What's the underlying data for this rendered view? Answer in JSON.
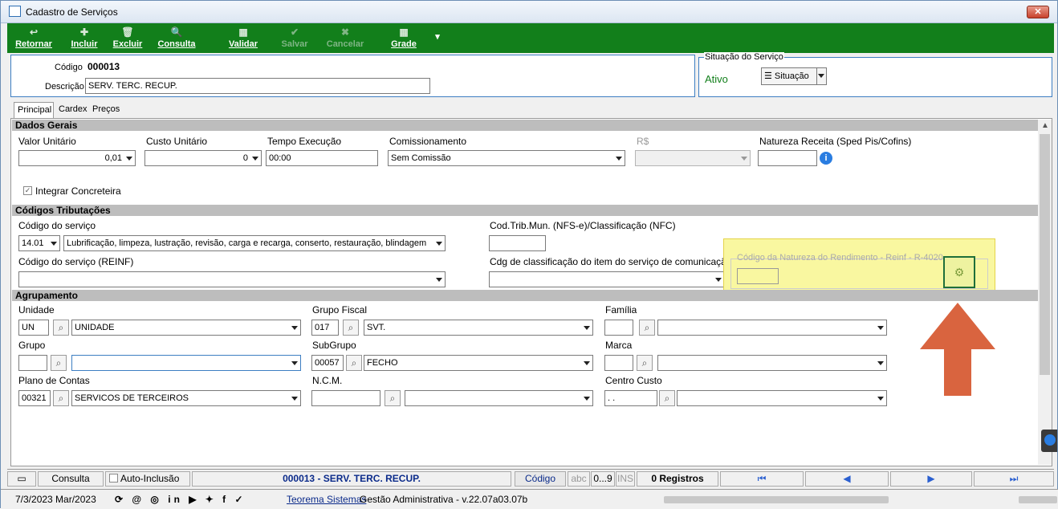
{
  "window": {
    "title": "Cadastro de Serviços",
    "close": "✕"
  },
  "toolbar": {
    "buttons": [
      {
        "label": "Retornar",
        "icon": "↩"
      },
      {
        "label": "Incluir",
        "icon": "✚"
      },
      {
        "label": "Excluir",
        "icon": "🗑"
      },
      {
        "label": "Consulta",
        "icon": "🔍"
      },
      {
        "label": "Validar",
        "icon": "▦"
      },
      {
        "label": "Salvar",
        "icon": "✔"
      },
      {
        "label": "Cancelar",
        "icon": "✖"
      },
      {
        "label": "Grade",
        "icon": "▦"
      }
    ],
    "more": "▾"
  },
  "header": {
    "codigo_label": "Código",
    "codigo_value": "000013",
    "descricao_label": "Descrição",
    "descricao_value": "SERV. TERC. RECUP."
  },
  "situacao": {
    "legend": "Situação do Serviço",
    "status": "Ativo",
    "button": "☰ Situação",
    "status_color": "#127f1b"
  },
  "tabs": [
    "Principal",
    "Cardex",
    "Preços"
  ],
  "dados_gerais": {
    "title": "Dados Gerais",
    "valor_unitario_label": "Valor Unitário",
    "valor_unitario": "0,01",
    "custo_unitario_label": "Custo Unitário",
    "custo_unitario": "0",
    "tempo_execucao_label": "Tempo Execução",
    "tempo_execucao": "00:00",
    "comissionamento_label": "Comissionamento",
    "comissionamento": "Sem Comissão",
    "rs_label": "R$",
    "natureza_label": "Natureza Receita (Sped Pis/Cofins)",
    "integrar_label": "Integrar Concreteira",
    "integrar_checked": true
  },
  "codigos": {
    "title": "Códigos Tributações",
    "codigo_servico_label": "Código do serviço",
    "codigo_servico_num": "14.01",
    "codigo_servico_desc": "Lubrificação, limpeza, lustração, revisão, carga e recarga, conserto, restauração, blindagem",
    "codtrib_label": "Cod.Trib.Mun. (NFS-e)/Classificação (NFC)",
    "reinf_label": "Código do serviço (REINF)",
    "cdg_comunic_label": "Cdg de classificação do item do serviço de comunicação",
    "natureza_rend_label": "Código da Natureza do Rendimento - Reinf - R-4020"
  },
  "agrupamento": {
    "title": "Agrupamento",
    "unidade_label": "Unidade",
    "unidade_code": "UN",
    "unidade_desc": "UNIDADE",
    "grupo_fiscal_label": "Grupo Fiscal",
    "grupo_fiscal_code": "017",
    "grupo_fiscal_desc": "SVT.",
    "familia_label": "Família",
    "grupo_label": "Grupo",
    "subgrupo_label": "SubGrupo",
    "subgrupo_code": "00057",
    "subgrupo_desc": "FECHO",
    "marca_label": "Marca",
    "plano_label": "Plano de Contas",
    "plano_code": "00321",
    "plano_desc": "SERVICOS DE TERCEIROS",
    "ncm_label": "N.C.M.",
    "centro_label": "Centro Custo",
    "centro_code": ". ."
  },
  "statusbar": {
    "consulta": "Consulta",
    "auto_inclusao": "Auto-Inclusão",
    "record": "000013 - SERV. TERC. RECUP.",
    "codigo": "Código",
    "abc": "abc",
    "range": "0...9",
    "ins": "INS",
    "registros": "0 Registros",
    "nav_first": "⏮",
    "nav_prev": "◀",
    "nav_next": "▶",
    "nav_last": "⏭"
  },
  "footer": {
    "date": "7/3/2023 Mar/2023",
    "social": "⟳ @ ◎ in ▶ ✦ f ✓",
    "company": "Teorema Sistemas",
    "version": "Gestão Administrativa - v.22.07a03.07b"
  },
  "highlight": {
    "arrow_color": "#d9643f"
  }
}
